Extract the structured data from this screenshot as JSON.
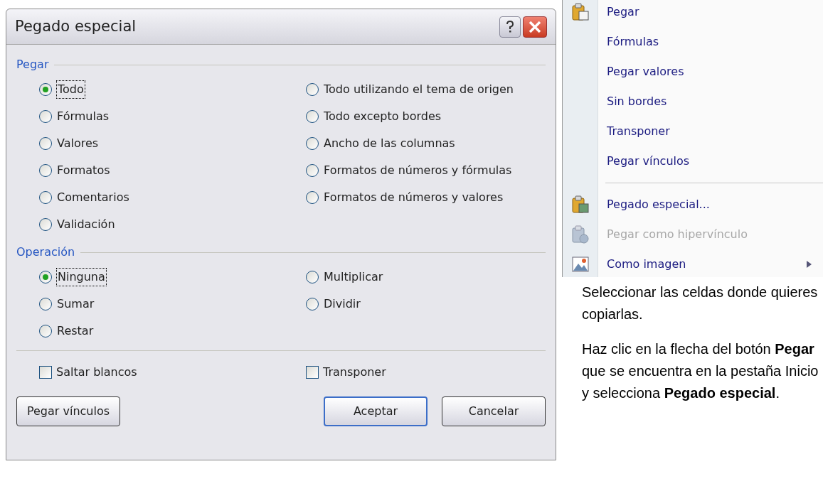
{
  "dialog": {
    "title": "Pegado especial",
    "paste_group": {
      "label": "Pegar",
      "left": [
        {
          "label": "Todo",
          "selected": true
        },
        {
          "label": "Fórmulas",
          "selected": false
        },
        {
          "label": "Valores",
          "selected": false
        },
        {
          "label": "Formatos",
          "selected": false
        },
        {
          "label": "Comentarios",
          "selected": false
        },
        {
          "label": "Validación",
          "selected": false
        }
      ],
      "right": [
        {
          "label": "Todo utilizando el tema de origen",
          "selected": false
        },
        {
          "label": "Todo excepto bordes",
          "selected": false
        },
        {
          "label": "Ancho de las columnas",
          "selected": false
        },
        {
          "label": "Formatos de números y fórmulas",
          "selected": false
        },
        {
          "label": "Formatos de números y valores",
          "selected": false
        }
      ]
    },
    "operation_group": {
      "label": "Operación",
      "left": [
        {
          "label": "Ninguna",
          "selected": true
        },
        {
          "label": "Sumar",
          "selected": false
        },
        {
          "label": "Restar",
          "selected": false
        }
      ],
      "right": [
        {
          "label": "Multiplicar",
          "selected": false
        },
        {
          "label": "Dividir",
          "selected": false
        }
      ]
    },
    "checkboxes": [
      {
        "label": "Saltar blancos",
        "checked": false
      },
      {
        "label": "Transponer",
        "checked": false
      }
    ],
    "buttons": [
      {
        "label": "Pegar vínculos",
        "kind": "normal"
      },
      {
        "label": "Aceptar",
        "kind": "default"
      },
      {
        "label": "Cancelar",
        "kind": "normal"
      }
    ]
  },
  "menu": {
    "items": [
      {
        "label": "Pegar",
        "kind": "item",
        "disabled": false,
        "submenu": false
      },
      {
        "label": "Fórmulas",
        "kind": "item",
        "disabled": false,
        "submenu": false
      },
      {
        "label": "Pegar valores",
        "kind": "item",
        "disabled": false,
        "submenu": false
      },
      {
        "label": "Sin bordes",
        "kind": "item",
        "disabled": false,
        "submenu": false
      },
      {
        "label": "Transponer",
        "kind": "item",
        "disabled": false,
        "submenu": false
      },
      {
        "label": "Pegar vínculos",
        "kind": "item",
        "disabled": false,
        "submenu": false
      },
      {
        "kind": "separator"
      },
      {
        "label": "Pegado especial...",
        "kind": "item",
        "disabled": false,
        "submenu": false
      },
      {
        "label": "Pegar como hipervínculo",
        "kind": "item",
        "disabled": true,
        "submenu": false
      },
      {
        "label": "Como imagen",
        "kind": "item",
        "disabled": false,
        "submenu": true
      }
    ]
  },
  "paragraphs": [
    "Seleccionar las celdas donde quieres copiarlas.",
    "Haz clic en la flecha del botón **Pegar** que se encuentra en la pestaña Inicio y selecciona **Pegado especial**."
  ]
}
